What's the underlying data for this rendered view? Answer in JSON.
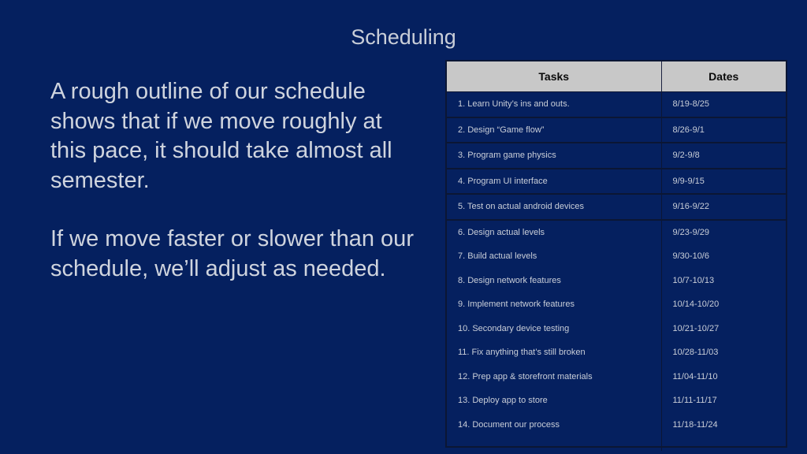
{
  "slide": {
    "title": "Scheduling",
    "paragraphs": [
      "A rough outline of our schedule shows that if we move roughly at this pace, it should take almost all semester.",
      "If we move faster or slower than our schedule, we’ll adjust as needed."
    ]
  },
  "table": {
    "headers": [
      "Tasks",
      "Dates"
    ],
    "rows": [
      {
        "task": "1. Learn Unity’s ins and outs.",
        "dates": "8/19-8/25"
      },
      {
        "task": "2. Design “Game flow”",
        "dates": "8/26-9/1"
      },
      {
        "task": "3. Program game physics",
        "dates": "9/2-9/8"
      },
      {
        "task": "4. Program UI interface",
        "dates": "9/9-9/15"
      },
      {
        "task": "5. Test on actual android devices",
        "dates": "9/16-9/22"
      },
      {
        "task": "6. Design actual levels",
        "dates": "9/23-9/29"
      },
      {
        "task": "7. Build actual levels",
        "dates": "9/30-10/6"
      },
      {
        "task": "8. Design network features",
        "dates": "10/7-10/13"
      },
      {
        "task": "9. Implement network features",
        "dates": "10/14-10/20"
      },
      {
        "task": "10. Secondary device testing",
        "dates": "10/21-10/27"
      },
      {
        "task": "11. Fix anything that’s still broken",
        "dates": "10/28-11/03"
      },
      {
        "task": "12. Prep app & storefront materials",
        "dates": "11/04-11/10"
      },
      {
        "task": "13. Deploy app to store",
        "dates": "11/11-11/17"
      },
      {
        "task": "14. Document our process",
        "dates": "11/18-11/24"
      }
    ]
  }
}
